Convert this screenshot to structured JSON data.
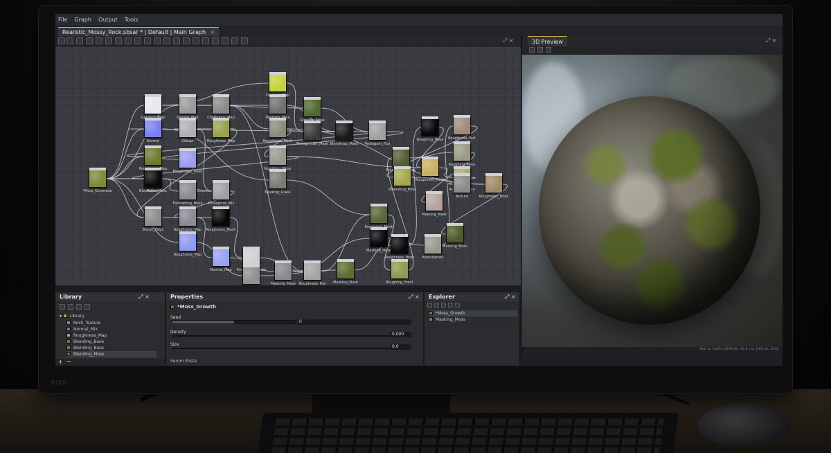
{
  "menu": {
    "items": [
      "File",
      "Graph",
      "Output",
      "Tools"
    ]
  },
  "document_tab": {
    "title": "Realistic_Mossy_Rock.sbsar * | Default | Main Graph",
    "close": "×"
  },
  "window_controls": {
    "graph": "⤢ ×",
    "preview": "⤢ ×",
    "panel": "⤢ ×"
  },
  "preview": {
    "tab": "3D Preview",
    "status": "Shot on Fujifilm GFX100s, f/2.8, iso, 1/60 ms, 2014"
  },
  "graph_nodes": [
    {
      "label": "Gradient_Map",
      "color": "#e8e8ea"
    },
    {
      "label": "Dircent_Map",
      "color": "#9a9a9a"
    },
    {
      "label": "Continious_Map",
      "color": "#8a8a8a"
    },
    {
      "label": "Contrast_Map",
      "color": "#c6d23a"
    },
    {
      "label": "Matrises_Pikia",
      "color": "#6f6f6f"
    },
    {
      "label": "Growing_Moss",
      "color": "#4e6a2c"
    },
    {
      "label": "Roughness_Mosk",
      "color": "#8c8a7a"
    },
    {
      "label": "Mossgrinder_Mask",
      "color": "#3a3a3a"
    },
    {
      "label": "Roughness_Map",
      "color": "#9aa04a"
    },
    {
      "label": "Blendmap_Mask",
      "color": "#1a1a1a"
    },
    {
      "label": "Pediagam_Fios",
      "color": "#a0a0a0"
    },
    {
      "label": "Roughing_Moss",
      "color": "#9a9890"
    },
    {
      "label": "Normal",
      "color": "#7a7ff2"
    },
    {
      "label": "Gilkupr",
      "color": "#b0b0b0"
    },
    {
      "label": "Roughness_Map",
      "color": "#6f7a2e"
    },
    {
      "label": "Roughness_Mask",
      "color": "#9a9cf0"
    },
    {
      "label": "Bloodrose_Moss",
      "color": "#909090"
    },
    {
      "label": "Masking_Grass",
      "color": "#7d7a72"
    },
    {
      "label": "*Moss_Generator",
      "color": "#7c8a3a"
    },
    {
      "label": "Pattern",
      "color": "#0b0b0c"
    },
    {
      "label": "Formatting_Mask",
      "color": "#8a8c94"
    },
    {
      "label": "Incomprise_Mix",
      "color": "#a0a0a0"
    },
    {
      "label": "Bloom_Edge",
      "color": "#8c8c8c"
    },
    {
      "label": "Roughness_Map",
      "color": "#8a8a98"
    },
    {
      "label": "Roughness_Mask",
      "color": "#080808"
    },
    {
      "label": "Roughness_Map",
      "color": "#8f9bf0"
    },
    {
      "label": "Normal_Map",
      "color": "#9aa0f2"
    },
    {
      "label": "Formatting_Mask",
      "color": "#d0d0d0"
    },
    {
      "label": "Roughness_Map",
      "color": "#909090"
    },
    {
      "label": "Masking_Moss",
      "color": "#8a8a8a"
    },
    {
      "label": "Roughness_Pos",
      "color": "#a4a4a4"
    },
    {
      "label": "Masking_Nuse",
      "color": "#5e6e34"
    },
    {
      "label": "Masking_Nuse",
      "color": "#080808"
    },
    {
      "label": "Enroppest_Mask",
      "color": "#58663a"
    },
    {
      "label": "Roughness_Mosk",
      "color": "#0a0a0a"
    },
    {
      "label": "Aldenhanser",
      "color": "#9a9a8c"
    },
    {
      "label": "Roughing_Prent",
      "color": "#8e9a50"
    },
    {
      "label": "Roughing_Mask",
      "color": "#080808"
    },
    {
      "label": "Roughness_Part",
      "color": "#a08a7a"
    },
    {
      "label": "Roughness_Mask",
      "color": "#555c30"
    },
    {
      "label": "Roughness_Mesh",
      "color": "#c8b060"
    },
    {
      "label": "Bleending_Moss",
      "color": "#a4a84a"
    },
    {
      "label": "Roughing_Moss",
      "color": "#9a9a86"
    },
    {
      "label": "Roughing_Stun",
      "color": "#b4a86a"
    },
    {
      "label": "Roughness_Mosk",
      "color": "#a08a6a"
    },
    {
      "label": "Masking_Mask",
      "color": "#b8a2a0"
    },
    {
      "label": "Texture",
      "color": "#8a8a8a"
    },
    {
      "label": "Masking_Moss",
      "color": "#4e5a2c"
    }
  ],
  "library": {
    "title": "Library",
    "root": "Library",
    "items": [
      {
        "label": "Rock_Texture",
        "color": "#8a8a8a"
      },
      {
        "label": "Normal_Mix",
        "color": "#7a7a7a"
      },
      {
        "label": "Roughness_Map",
        "color": "#9a9a9a"
      },
      {
        "label": "Blending_Base",
        "color": "#6a7a3a"
      },
      {
        "label": "Blending_Base",
        "color": "#7a7a6a"
      },
      {
        "label": "Blending_Moss",
        "color": "#5a6a2a"
      }
    ]
  },
  "properties": {
    "title": "Properties",
    "node": "*Moss_Growth",
    "seed": {
      "label": "Seed",
      "value": "0",
      "level": 0.5
    },
    "density": {
      "label": "Density",
      "value": "0.000",
      "level": 0.5
    },
    "size": {
      "label": "Size",
      "value": "0.0",
      "level": 0.5
    },
    "footer": "Serom Ebste"
  },
  "explorer": {
    "title": "Explorer",
    "items": [
      {
        "label": "*Moss_Growth",
        "color": "#6a7a3a"
      },
      {
        "label": "Masking_Moss",
        "color": "#7a7a5a"
      }
    ]
  },
  "bezel": {
    "brand": "EIZO"
  }
}
